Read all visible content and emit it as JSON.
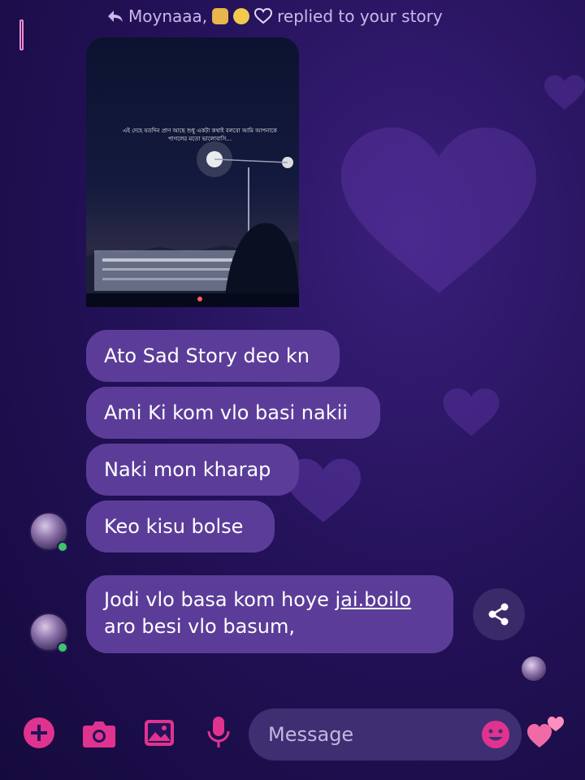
{
  "reply_header": {
    "name": "Moynaaa,",
    "text": "replied to your story"
  },
  "story": {
    "caption": "এই দেহে যতদিন প্রাণ আছে শুধু একটা কথাই বলবো আমি আপনাকে পাগলের মতো ভালোবাসি..."
  },
  "messages": [
    {
      "text": "Ato Sad Story deo kn"
    },
    {
      "text": "Ami Ki kom vlo basi nakii"
    },
    {
      "text": "Naki mon kharap"
    },
    {
      "text": "Keo kisu bolse"
    }
  ],
  "last_message": {
    "part1": "Jodi vlo basa kom hoye ",
    "link": "jai.boilo",
    "line2": "aro besi vlo basum,"
  },
  "composer": {
    "placeholder": "Message"
  },
  "colors": {
    "bubble": "#5b3d99",
    "accent": "#e0338f",
    "online": "#3cc66a"
  },
  "icons": [
    "reply-arrow-icon",
    "cat-emoji-icon",
    "smile-emoji-icon",
    "heart-hands-emoji-icon",
    "share-icon",
    "plus-icon",
    "camera-icon",
    "gallery-icon",
    "microphone-icon",
    "emoji-icon",
    "hearts-icon"
  ]
}
